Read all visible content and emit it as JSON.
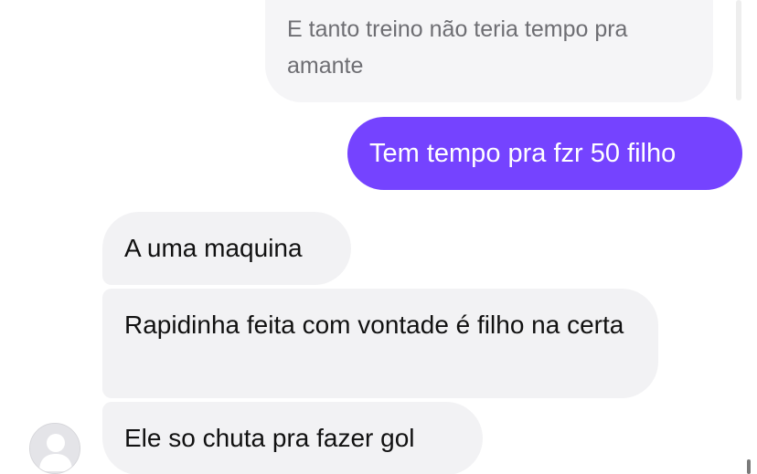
{
  "messages": {
    "quoted": "E tanto treino não teria tempo pra amante",
    "sent": "Tem tempo pra fzr 50 filho",
    "received_1": "A uma maquina",
    "received_2": "Rapidinha feita com vontade é filho na certa",
    "received_3": "Ele so chuta pra fazer gol"
  },
  "colors": {
    "sent_bubble": "#7543ff",
    "received_bubble": "#f2f2f4",
    "quoted_text": "#6e6e73"
  },
  "icons": {
    "avatar": "default-person-avatar-icon"
  }
}
